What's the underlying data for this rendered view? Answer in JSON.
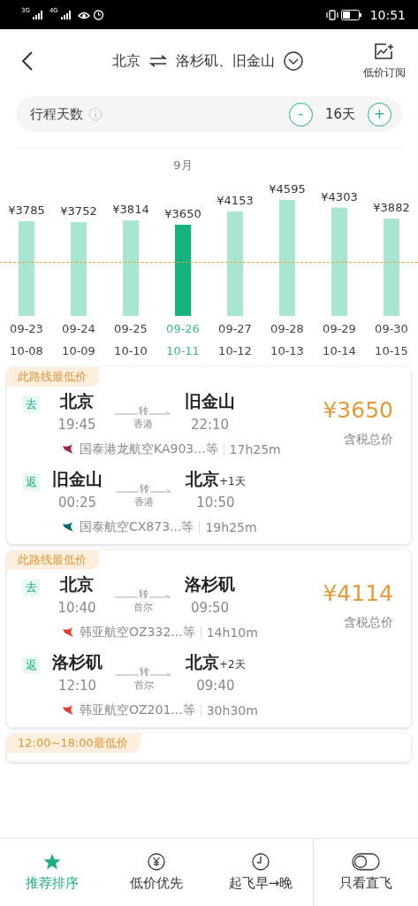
{
  "status_bar": {
    "signal_1": "3G",
    "signal_2": "4G",
    "time": "10:51"
  },
  "header": {
    "from": "北京",
    "to": "洛杉矶、旧金山",
    "subscribe": "低价订阅"
  },
  "trip_days": {
    "label": "行程天数",
    "minus": "-",
    "value": "16天",
    "plus": "+"
  },
  "month": "9月",
  "chart_data": {
    "type": "bar",
    "categories": [
      "09-23",
      "09-24",
      "09-25",
      "09-26",
      "09-27",
      "09-28",
      "09-29",
      "09-30"
    ],
    "values": [
      3785,
      3752,
      3814,
      3650,
      4153,
      4595,
      4303,
      3882
    ],
    "value_labels": [
      "¥3785",
      "¥3752",
      "¥3814",
      "¥3650",
      "¥4153",
      "¥4595",
      "¥4303",
      "¥3882"
    ]
  },
  "dates": [
    {
      "return": "10-08",
      "selected": false
    },
    {
      "return": "10-09",
      "selected": false
    },
    {
      "return": "10-10",
      "selected": false
    },
    {
      "return": "10-11",
      "selected": true
    },
    {
      "return": "10-12",
      "selected": false
    },
    {
      "return": "10-13",
      "selected": false
    },
    {
      "return": "10-14",
      "selected": false
    },
    {
      "return": "10-15",
      "selected": false
    }
  ],
  "cards": [
    {
      "tag": "此路线最低价",
      "price": "¥3650",
      "price_note": "含税总价",
      "legs": [
        {
          "dir": "去",
          "from": "北京",
          "to": "旧金山",
          "depart": "19:45",
          "arrive": "22:10",
          "via": "转",
          "via_city": "香港",
          "airline": "国泰港龙航空KA903...等",
          "duration": "17h25m",
          "color": "#a3243b"
        },
        {
          "dir": "返",
          "from": "旧金山",
          "to": "北京",
          "day_offset": "+1天",
          "depart": "00:25",
          "arrive": "10:50",
          "via": "转",
          "via_city": "香港",
          "airline": "国泰航空CX873...等",
          "duration": "19h25m",
          "color": "#0b6a6e"
        }
      ]
    },
    {
      "tag": "此路线最低价",
      "price": "¥4114",
      "price_note": "含税总价",
      "legs": [
        {
          "dir": "去",
          "from": "北京",
          "to": "洛杉矶",
          "depart": "10:40",
          "arrive": "09:50",
          "via": "转",
          "via_city": "首尔",
          "airline": "韩亚航空OZ332...等",
          "duration": "14h10m",
          "color": "#e23a2c"
        },
        {
          "dir": "返",
          "from": "洛杉矶",
          "to": "北京",
          "day_offset": "+2天",
          "depart": "12:10",
          "arrive": "09:40",
          "via": "转",
          "via_city": "首尔",
          "airline": "韩亚航空OZ201...等",
          "duration": "30h30m",
          "color": "#e23a2c"
        }
      ]
    },
    {
      "tag": "12:00~18:00最低价"
    }
  ],
  "bottom_tabs": [
    {
      "kind": "star",
      "label": "推荐排序",
      "selected": true
    },
    {
      "kind": "yen",
      "label": "低价优先",
      "selected": false
    },
    {
      "kind": "clock",
      "label": "起飞早→晚",
      "selected": false
    },
    {
      "kind": "toggle",
      "label": "只看直飞",
      "selected": false
    }
  ]
}
